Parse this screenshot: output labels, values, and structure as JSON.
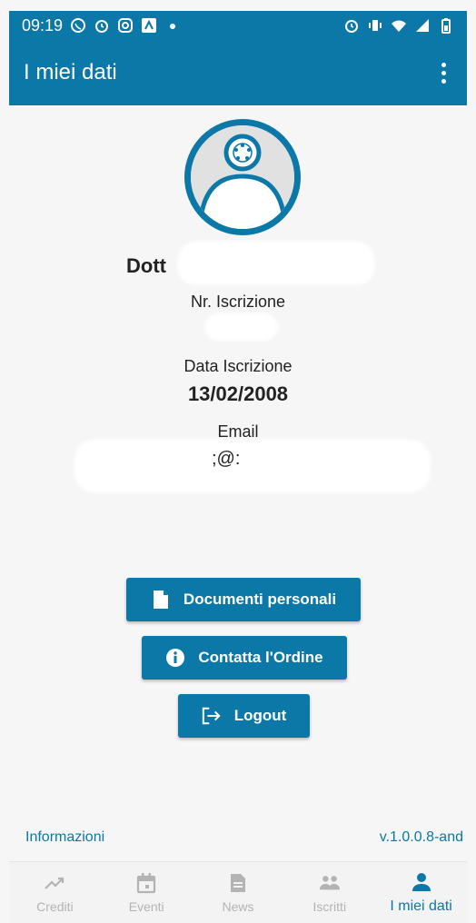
{
  "status_bar": {
    "time": "09:19",
    "left_icons": [
      "whatsapp-icon",
      "alarm-icon",
      "instagram-icon",
      "app-icon",
      "dot-icon"
    ],
    "right_icons": [
      "alarm-icon",
      "vibrate-icon",
      "wifi-icon",
      "signal-icon",
      "battery-icon"
    ]
  },
  "app_bar": {
    "title": "I miei dati",
    "menu_icon": "more-vert-icon"
  },
  "profile": {
    "name_prefix": "Dott",
    "registration_number_label": "Nr. Iscrizione",
    "registration_date_label": "Data Iscrizione",
    "registration_date": "13/02/2008",
    "email_label": "Email",
    "email_visible_fragment": ";@:"
  },
  "actions": {
    "documents_label": "Documenti personali",
    "contact_label": "Contatta l'Ordine",
    "logout_label": "Logout"
  },
  "footer": {
    "info_link": "Informazioni",
    "version": "v.1.0.0.8-and"
  },
  "bottom_nav": [
    {
      "label": "Crediti",
      "icon": "trending-up-icon",
      "active": false
    },
    {
      "label": "Eventi",
      "icon": "calendar-icon",
      "active": false
    },
    {
      "label": "News",
      "icon": "article-icon",
      "active": false
    },
    {
      "label": "Iscritti",
      "icon": "people-icon",
      "active": false
    },
    {
      "label": "I miei dati",
      "icon": "person-icon",
      "active": true
    }
  ],
  "colors": {
    "primary": "#0b78a8",
    "background": "#f6f6f6",
    "inactive": "#b3b3b3"
  }
}
